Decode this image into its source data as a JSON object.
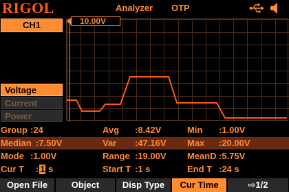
{
  "header": {
    "brand": "RIGOL",
    "mode": "Analyzer",
    "trigger": "OTP",
    "icons": [
      "usb-icon",
      "speaker-icon"
    ]
  },
  "channel": {
    "label": "CH1"
  },
  "scale": {
    "label": "10.00V"
  },
  "measure_types": [
    {
      "label": "Voltage",
      "active": true
    },
    {
      "label": "Current",
      "active": false
    },
    {
      "label": "Power",
      "active": false
    }
  ],
  "stats": {
    "group_label": "Group",
    "group_value": ":24",
    "avg_label": "Avg",
    "avg_value": ":8.42V",
    "min_label": "Min",
    "min_value": ":1.00V",
    "median_label": "Median",
    "median_value": ":7.50V",
    "var_label": "Var",
    "var_value": ":47.16V",
    "max_label": "Max",
    "max_value": ":20.00V",
    "mode_label": "Mode",
    "mode_value": ":1.00V",
    "range_label": "Range",
    "range_value": ":19.00V",
    "meand_label": "MeanD",
    "meand_value": ":5.75V",
    "curt_label": "Cur T",
    "curt_prefix": ":",
    "curt_digit": "1",
    "curt_unit": "s",
    "startt_label": "Start T",
    "startt_value": ":1 s",
    "endt_label": "End T",
    "endt_value": ":24 s"
  },
  "menu": [
    {
      "label": "Open File",
      "active": false
    },
    {
      "label": "Object",
      "active": false
    },
    {
      "label": "Disp Type",
      "active": false
    },
    {
      "label": "Cur Time",
      "active": true
    },
    {
      "label": "⇨1/2",
      "active": false
    }
  ],
  "colors": {
    "accent": "#ff8c2e",
    "brand": "#ff5a14",
    "highlight_row": "#6a2a12",
    "grid": "#4a2e18"
  }
}
